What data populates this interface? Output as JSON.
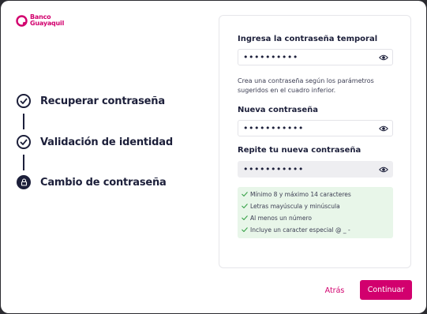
{
  "brand": {
    "line1": "Banco",
    "line2": "Guayaquil",
    "color": "#d2006e"
  },
  "steps": [
    {
      "label": "Recuperar contraseña",
      "state": "completed",
      "icon": "check-icon"
    },
    {
      "label": "Validación de identidad",
      "state": "completed",
      "icon": "check-icon"
    },
    {
      "label": "Cambio de contraseña",
      "state": "current",
      "icon": "lock-icon"
    }
  ],
  "form": {
    "temp_password": {
      "label": "Ingresa la contraseña temporal",
      "value": "••••••••••"
    },
    "hint": "Crea una contraseña según los parámetros sugeridos en el cuadro inferior.",
    "new_password": {
      "label": "Nueva contraseña",
      "value": "•••••••••••"
    },
    "repeat_password": {
      "label": "Repite tu nueva contraseña",
      "value": "•••••••••••"
    },
    "requirements": [
      "Mínimo 8 y máximo 14 caracteres",
      "Letras mayúscula y minúscula",
      "Al menos un número",
      "Incluye un caracter especial @ _ -"
    ]
  },
  "actions": {
    "back": "Atrás",
    "continue": "Continuar"
  },
  "colors": {
    "accent": "#d2006e",
    "navy": "#1c1f3a",
    "success_bg": "#e8f6e9",
    "success": "#3aa34a"
  }
}
